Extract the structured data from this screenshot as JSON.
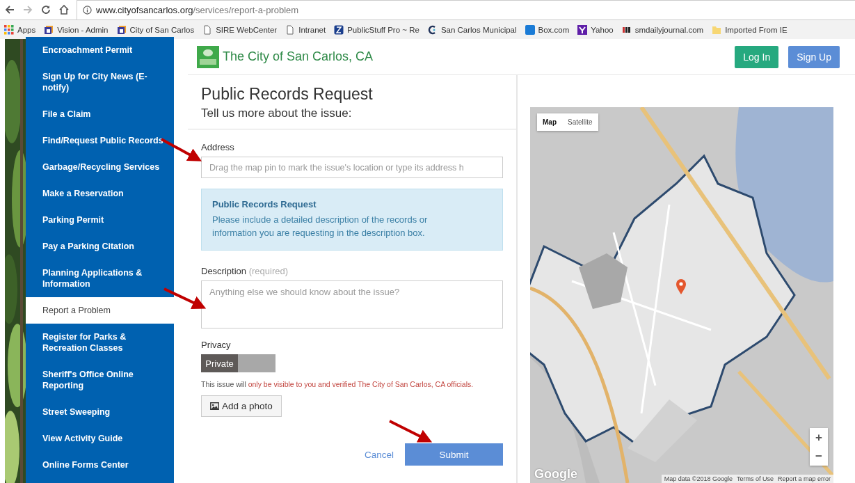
{
  "browser": {
    "url": {
      "domain": "www.cityofsancarlos.org",
      "path": "/services/report-a-problem"
    },
    "bookmarks": [
      {
        "label": "Apps",
        "kind": "apps"
      },
      {
        "label": "Vision - Admin",
        "kind": "cube"
      },
      {
        "label": "City of San Carlos",
        "kind": "cube"
      },
      {
        "label": "SIRE WebCenter",
        "kind": "page"
      },
      {
        "label": "Intranet",
        "kind": "page"
      },
      {
        "label": "PublicStuff Pro ~ Re",
        "kind": "publicstuff"
      },
      {
        "label": "San Carlos Municipal",
        "kind": "ring"
      },
      {
        "label": "Box.com",
        "kind": "box"
      },
      {
        "label": "Yahoo",
        "kind": "yahoo"
      },
      {
        "label": "smdailyjournal.com",
        "kind": "dj"
      },
      {
        "label": "Imported From IE",
        "kind": "folder"
      }
    ]
  },
  "sidebar": {
    "items": [
      {
        "label": "Encroachment Permit",
        "selected": false
      },
      {
        "label": "Sign Up for City News (E-notify)",
        "selected": false
      },
      {
        "label": "File a Claim",
        "selected": false
      },
      {
        "label": "Find/Request Public Records",
        "selected": false
      },
      {
        "label": "Garbage/Recycling Services",
        "selected": false
      },
      {
        "label": "Make a Reservation",
        "selected": false
      },
      {
        "label": "Parking Permit",
        "selected": false
      },
      {
        "label": "Pay a Parking Citation",
        "selected": false
      },
      {
        "label": "Planning Applications & Information",
        "selected": false
      },
      {
        "label": "Report a Problem",
        "selected": true
      },
      {
        "label": "Register for Parks & Recreation Classes",
        "selected": false
      },
      {
        "label": "Sheriff's Office Online Reporting",
        "selected": false
      },
      {
        "label": "Street Sweeping",
        "selected": false
      },
      {
        "label": "View Activity Guide",
        "selected": false
      },
      {
        "label": "Online Forms Center",
        "selected": false
      }
    ]
  },
  "header": {
    "site_title": "The City of San Carlos, CA",
    "buttons": [
      {
        "label": "Log In",
        "kind": "login"
      },
      {
        "label": "Sign Up",
        "kind": "signup"
      }
    ]
  },
  "form": {
    "title": "Public Records Request",
    "subtitle": "Tell us more about the issue:",
    "address": {
      "label": "Address",
      "placeholder": "Drag the map pin to mark the issue's location or type its address h"
    },
    "notice": {
      "title": "Public Records Request",
      "text": "Please include a detailed description of the records or information you are requesting in the description box."
    },
    "description": {
      "label": "Description",
      "hint": "(required)",
      "placeholder": "Anything else we should know about the issue?"
    },
    "privacy": {
      "label": "Privacy",
      "toggle_label": "Private",
      "on": true
    },
    "note": {
      "prefix": "This issue will ",
      "highlight": "only be visible to you and verified The City of San Carlos, CA officials."
    },
    "add_photo": "Add a photo",
    "cancel": "Cancel",
    "submit": "Submit"
  },
  "map": {
    "map_types": [
      {
        "label": "Map",
        "selected": true
      },
      {
        "label": "Satellite",
        "selected": false
      }
    ],
    "zoom_in": "+",
    "zoom_out": "−",
    "logo": "Google",
    "attribution": [
      "Map data ©2018 Google",
      "Terms of Use",
      "Report a map error"
    ]
  }
}
